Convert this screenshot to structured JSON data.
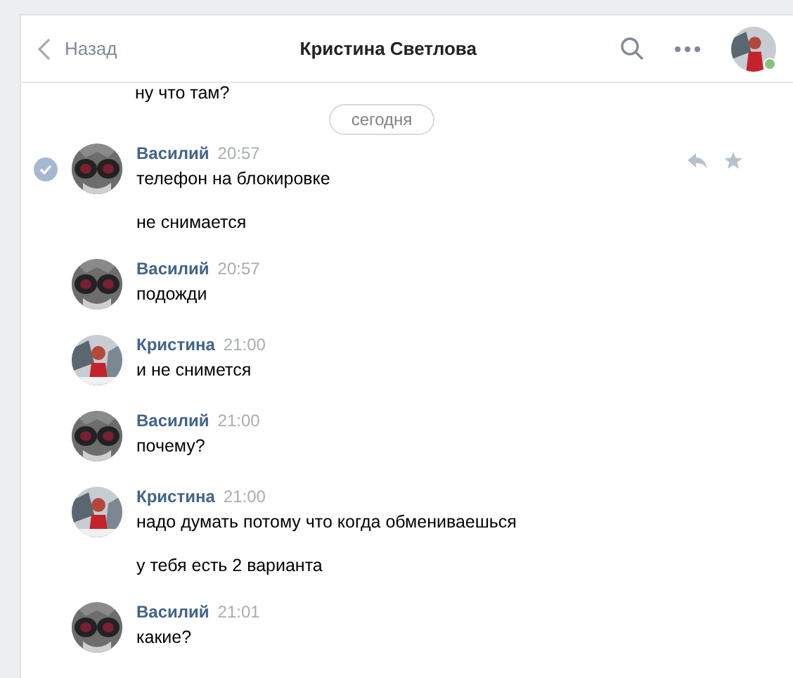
{
  "header": {
    "back": "Назад",
    "title": "Кристина Светлова",
    "online": true
  },
  "previous_text": "ну что там?",
  "date_divider": "сегодня",
  "messages": [
    {
      "kind": "outgoing",
      "author": "Василий",
      "time": "20:57",
      "selected": true,
      "lines": [
        "телефон на блокировке",
        "не снимается"
      ]
    },
    {
      "kind": "outgoing",
      "author": "Василий",
      "time": "20:57",
      "selected": false,
      "lines": [
        "подожди"
      ]
    },
    {
      "kind": "incoming",
      "author": "Кристина",
      "time": "21:00",
      "selected": false,
      "lines": [
        "и не снимется"
      ]
    },
    {
      "kind": "outgoing",
      "author": "Василий",
      "time": "21:00",
      "selected": false,
      "lines": [
        "почему?"
      ]
    },
    {
      "kind": "incoming",
      "author": "Кристина",
      "time": "21:00",
      "selected": false,
      "lines": [
        "надо думать потому что когда обмениваешься",
        "у тебя есть 2 варианта"
      ]
    },
    {
      "kind": "outgoing",
      "author": "Василий",
      "time": "21:01",
      "selected": false,
      "lines": [
        "какие?"
      ]
    }
  ]
}
